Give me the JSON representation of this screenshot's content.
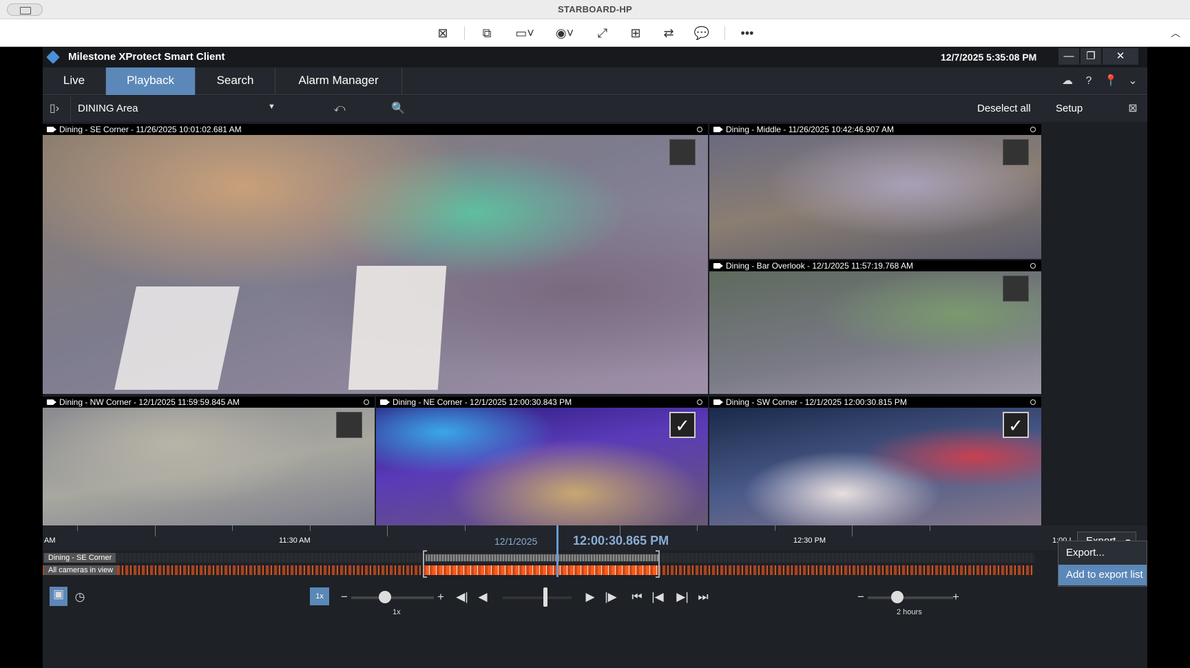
{
  "remote": {
    "title": "STARBOARD-HP",
    "tools": [
      "screen-icon",
      "monitor-switch-icon",
      "display-icon",
      "eye-icon",
      "fullscreen-icon",
      "scale-icon",
      "transfer-icon",
      "chat-icon",
      "more-icon"
    ]
  },
  "app": {
    "name": "Milestone XProtect Smart Client",
    "datetime": "12/7/2025 5:35:08 PM"
  },
  "tabs": [
    {
      "label": "Live"
    },
    {
      "label": "Playback"
    },
    {
      "label": "Search"
    },
    {
      "label": "Alarm Manager"
    }
  ],
  "view": {
    "name": "DINING Area",
    "deselect": "Deselect all",
    "setup": "Setup"
  },
  "cameras": [
    {
      "label": "Dining - SE Corner - 11/26/2025 10:01:02.681 AM",
      "checked": false
    },
    {
      "label": "Dining - Middle - 11/26/2025 10:42:46.907 AM",
      "checked": false
    },
    {
      "label": "Dining - Bar Overlook - 12/1/2025 11:57:19.768 AM",
      "checked": false
    },
    {
      "label": "Dining - NW Corner - 12/1/2025 11:59:59.845 AM",
      "checked": false
    },
    {
      "label": "Dining - NE Corner - 12/1/2025 12:00:30.843 PM",
      "checked": true
    },
    {
      "label": "Dining - SW Corner - 12/1/2025 12:00:30.815 PM",
      "checked": true
    }
  ],
  "timeline": {
    "left_label": "AM",
    "t1": "11:30 AM",
    "date": "12/1/2025",
    "current_time": "12:00:30.865 PM",
    "t2": "12:30 PM",
    "t3": "1:00 I",
    "track1": "Dining - SE Corner",
    "track2": "All cameras in view",
    "speed_badge": "1x",
    "speed_label": "1x",
    "span_label": "2 hours",
    "export_button": "Export",
    "menu": [
      "Export...",
      "Add to export list"
    ]
  }
}
